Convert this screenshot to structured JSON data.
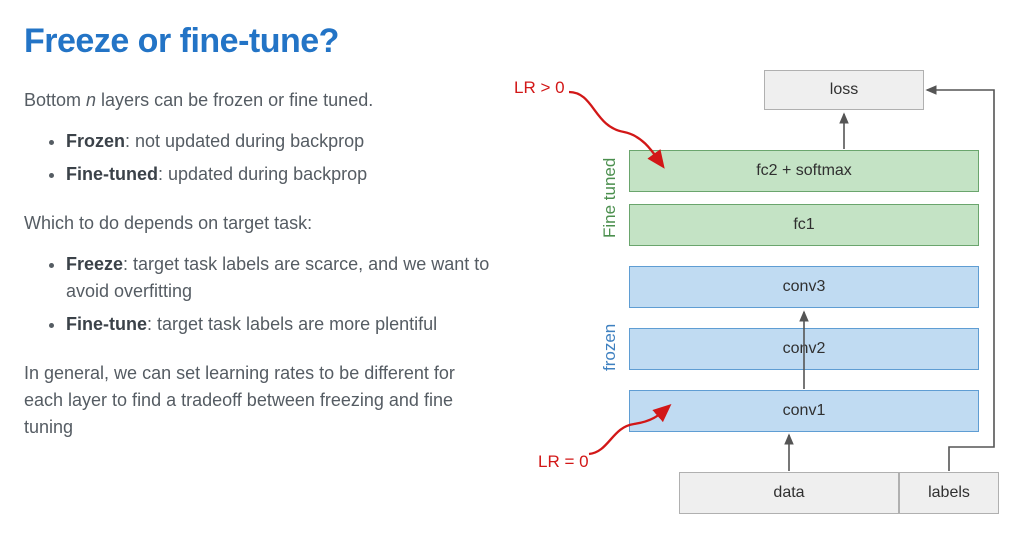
{
  "title": "Freeze or fine-tune?",
  "intro_pre": "Bottom ",
  "intro_var": "n",
  "intro_post": " layers can be frozen or fine tuned.",
  "bullets1": {
    "frozen_lbl": "Frozen",
    "frozen_txt": ": not updated during backprop",
    "finetuned_lbl": "Fine-tuned",
    "finetuned_txt": ": updated during backprop"
  },
  "which": "Which to do depends on target task:",
  "bullets2": {
    "freeze_lbl": "Freeze",
    "freeze_txt": ": target task labels are scarce, and we want to avoid overfitting",
    "finetune_lbl": "Fine-tune",
    "finetune_txt": ": target task labels are more plentiful"
  },
  "closing": "In general, we can set learning rates to be different for each layer to find a tradeoff between freezing and fine tuning",
  "diagram": {
    "loss": "loss",
    "fc2": "fc2 + softmax",
    "fc1": "fc1",
    "conv3": "conv3",
    "conv2": "conv2",
    "conv1": "conv1",
    "data": "data",
    "labels": "labels",
    "finetuned_label": "Fine tuned",
    "frozen_label": "frozen",
    "lr_top": "LR > 0",
    "lr_bot": "LR = 0"
  }
}
